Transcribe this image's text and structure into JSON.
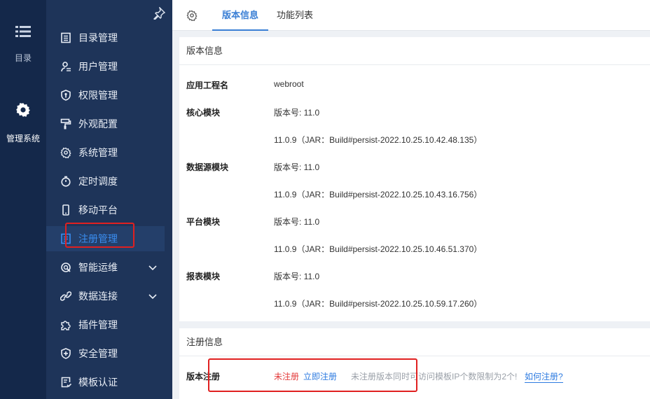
{
  "rail": {
    "items": [
      {
        "label": "目录",
        "icon": "list-icon"
      },
      {
        "label": "管理系统",
        "icon": "gear-icon"
      }
    ]
  },
  "menu": {
    "items": [
      {
        "label": "目录管理",
        "icon": "catalog-icon"
      },
      {
        "label": "用户管理",
        "icon": "user-icon"
      },
      {
        "label": "权限管理",
        "icon": "permission-shield-icon"
      },
      {
        "label": "外观配置",
        "icon": "paint-roller-icon"
      },
      {
        "label": "系统管理",
        "icon": "gear-icon"
      },
      {
        "label": "定时调度",
        "icon": "stopwatch-icon"
      },
      {
        "label": "移动平台",
        "icon": "mobile-icon"
      },
      {
        "label": "注册管理",
        "icon": "register-icon",
        "active": true
      },
      {
        "label": "智能运维",
        "icon": "ops-icon",
        "expandable": true
      },
      {
        "label": "数据连接",
        "icon": "link-icon",
        "expandable": true
      },
      {
        "label": "插件管理",
        "icon": "puzzle-icon"
      },
      {
        "label": "安全管理",
        "icon": "shield-plus-icon"
      },
      {
        "label": "模板认证",
        "icon": "template-cert-icon"
      }
    ]
  },
  "tabs": [
    {
      "label": "版本信息",
      "active": true
    },
    {
      "label": "功能列表",
      "active": false
    }
  ],
  "version": {
    "title": "版本信息",
    "rows": [
      {
        "key": "应用工程名",
        "value": "webroot"
      },
      {
        "key": "核心模块",
        "value": "版本号: 11.0"
      },
      {
        "key": "",
        "value": "11.0.9（JAR：Build#persist-2022.10.25.10.42.48.135）"
      },
      {
        "key": "数据源模块",
        "value": "版本号: 11.0"
      },
      {
        "key": "",
        "value": "11.0.9（JAR：Build#persist-2022.10.25.10.43.16.756）"
      },
      {
        "key": "平台模块",
        "value": "版本号: 11.0"
      },
      {
        "key": "",
        "value": "11.0.9（JAR：Build#persist-2022.10.25.10.46.51.370）"
      },
      {
        "key": "报表模块",
        "value": "版本号: 11.0"
      },
      {
        "key": "",
        "value": "11.0.9（JAR：Build#persist-2022.10.25.10.59.17.260）"
      }
    ]
  },
  "registration": {
    "title": "注册信息",
    "key": "版本注册",
    "status": "未注册",
    "register_link": "立即注册",
    "note": "未注册版本同时可访问模板IP个数限制为2个!",
    "help_link": "如何注册?"
  },
  "colors": {
    "rail_bg": "#14284a",
    "menu_bg": "#1e3459",
    "accent": "#3a7fd5",
    "status_red": "#e33b3b"
  }
}
